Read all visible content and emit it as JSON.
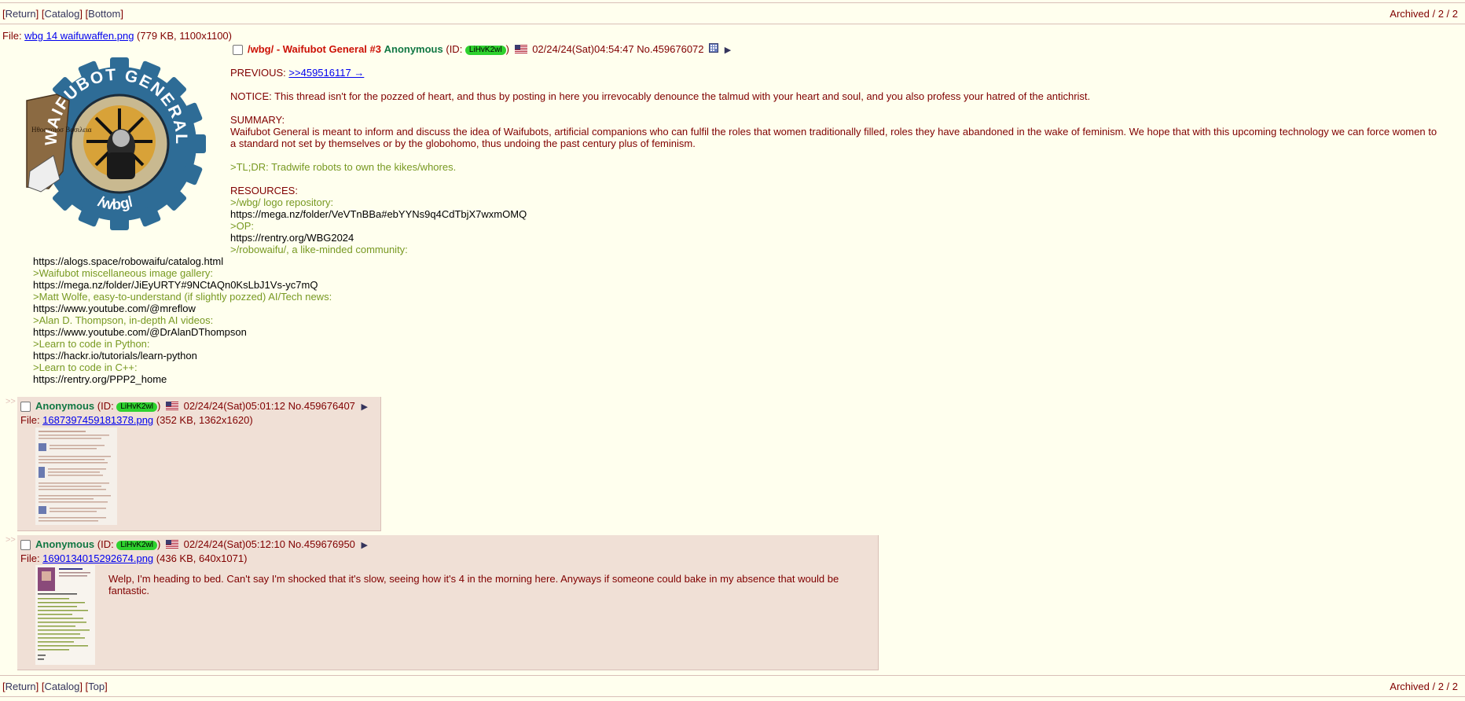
{
  "nav_top": {
    "return": "Return",
    "catalog": "Catalog",
    "bottom": "Bottom",
    "status": "Archived / 2 / 2"
  },
  "nav_bottom": {
    "return": "Return",
    "catalog": "Catalog",
    "top": "Top",
    "status": "Archived / 2 / 2"
  },
  "op": {
    "file_label": "File: ",
    "file_name": "wbg 14 waifuwaffen.png",
    "file_meta": "(779 KB, 1100x1100)",
    "logo_text_top": "WAIFUBOT GENERAL",
    "logo_text_bottom": "/wbg/",
    "logo_flag_text": "Ηθοσποιοσ Βασιλεια",
    "subject": "/wbg/ - Waifubot General #3",
    "name": "Anonymous",
    "id_prefix": "(ID: ",
    "poster_id": "LiHvK2wl",
    "id_suffix": ")",
    "datetime": "02/24/24(Sat)04:54:47",
    "post_no": "No.459676072",
    "arrow": "▶",
    "previous_label": "PREVIOUS: ",
    "previous_link": ">>459516117 →",
    "notice": "NOTICE: This thread isn't for the pozzed of heart, and thus by posting in here you irrevocably denounce the talmud with your heart and soul, and you also profess your hatred of the antichrist.",
    "summary_label": "SUMMARY:",
    "summary": "Waifubot General is meant to inform and discuss the idea of Waifubots, artificial companions who can fulfil the roles that women traditionally filled, roles they have abandoned in the wake of feminism. We hope that with this upcoming technology we can force women to a standard not set by themselves or by the globohomo, thus undoing the past century plus of feminism.",
    "tldr": ">TL;DR: Tradwife robots to own the kikes/whores.",
    "resources_label": "RESOURCES:",
    "res1_quote": ">/wbg/ logo repository:",
    "res1_link": "https://mega.nz/folder/VeVTnBBa#ebYYNs9q4CdTbjX7wxmOMQ",
    "res2_quote": ">OP:",
    "res2_link": "https://rentry.org/WBG2024",
    "res3_quote": ">/robowaifu/, a like-minded community:",
    "res3_link": "https://alogs.space/robowaifu/catalog.html",
    "res4_quote": ">Waifubot miscellaneous image gallery:",
    "res4_link": "https://mega.nz/folder/JiEyURTY#9NCtAQn0KsLbJ1Vs-yc7mQ",
    "res5_quote": ">Matt Wolfe, easy-to-understand (if slightly pozzed) AI/Tech news:",
    "res5_link": "https://www.youtube.com/@mreflow",
    "res6_quote": ">Alan D. Thompson, in-depth AI videos:",
    "res6_link": "https://www.youtube.com/@DrAlanDThompson",
    "res7_quote": ">Learn to code in Python:",
    "res7_link": "https://hackr.io/tutorials/learn-python",
    "res8_quote": ">Learn to code in C++:",
    "res8_link": "https://rentry.org/PPP2_home"
  },
  "replies": [
    {
      "side": ">>",
      "name": "Anonymous",
      "id_prefix": "(ID: ",
      "poster_id": "LiHvK2wl",
      "id_suffix": ")",
      "datetime": "02/24/24(Sat)05:01:12",
      "post_no": "No.459676407",
      "arrow": "▶",
      "file_label": "File: ",
      "file_name": "1687397459181378.png",
      "file_meta": "(352 KB, 1362x1620)",
      "text": ""
    },
    {
      "side": ">>",
      "name": "Anonymous",
      "id_prefix": "(ID: ",
      "poster_id": "LiHvK2wl",
      "id_suffix": ")",
      "datetime": "02/24/24(Sat)05:12:10",
      "post_no": "No.459676950",
      "arrow": "▶",
      "file_label": "File: ",
      "file_name": "1690134015292674.png",
      "file_meta": "(436 KB, 640x1071)",
      "text": "Welp, I'm heading to bed. Can't say I'm shocked that it's slow, seeing how it's 4 in the morning here. Anyways if someone could bake in my absence that would be fantastic."
    }
  ],
  "colors": {
    "background": "#FFFFEE",
    "reply_bg": "#F0E0D6",
    "text": "#800000",
    "name": "#117743",
    "subject": "#CC1105",
    "greentext": "#789922",
    "id_badge": "#2ED12E",
    "logo_blue": "#2E6C96"
  }
}
